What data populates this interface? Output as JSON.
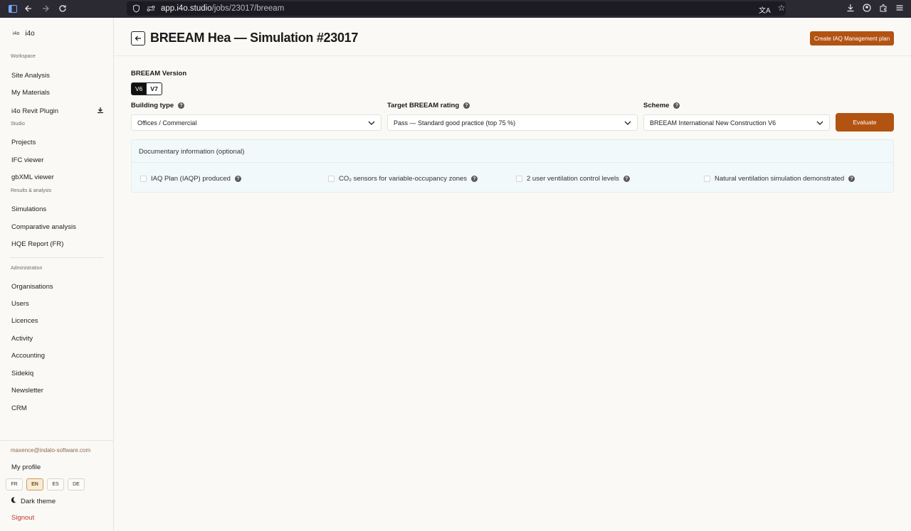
{
  "browser": {
    "url_host": "app.i4o.studio",
    "url_path": "/jobs/23017/breeam"
  },
  "logo": {
    "mark": "i4o",
    "name": "i4o"
  },
  "sidebar": {
    "workspace_heading": "Workspace",
    "workspace": [
      "Site Analysis",
      "My Materials",
      "i4o Revit Plugin"
    ],
    "studio_heading": "Studio",
    "studio": [
      "Projects",
      "IFC viewer",
      "gbXML viewer"
    ],
    "results_heading": "Results & analysis",
    "results": [
      "Simulations",
      "Comparative analysis",
      "HQE Report (FR)"
    ],
    "admin_heading": "Administration",
    "admin": [
      "Organisations",
      "Users",
      "Licences",
      "Activity",
      "Accounting",
      "Sidekiq",
      "Newsletter",
      "CRM"
    ],
    "user_email": "maxence@indalo-software.com",
    "my_profile": "My profile",
    "languages": [
      "FR",
      "EN",
      "ES",
      "DE"
    ],
    "active_language": "EN",
    "dark_theme": "Dark theme",
    "signout": "Signout"
  },
  "header": {
    "title": "BREEAM Hea — Simulation #23017",
    "create_plan": "Create IAQ Management plan"
  },
  "form": {
    "version_label": "BREEAM Version",
    "versions": [
      "V6",
      "V7"
    ],
    "selected_version": "V6",
    "building_type_label": "Building type",
    "building_type_value": "Offices / Commercial",
    "target_label": "Target BREEAM rating",
    "target_value": "Pass — Standard good practice (top 75 %)",
    "scheme_label": "Scheme",
    "scheme_value": "BREEAM International New Construction V6",
    "evaluate": "Evaluate"
  },
  "documentary": {
    "title": "Documentary information (optional)",
    "items": [
      "IAQ Plan (IAQP) produced",
      "CO₂ sensors for variable-occupancy zones",
      "2 user ventilation control levels",
      "Natural ventilation simulation demonstrated"
    ]
  },
  "colors": {
    "accent": "#b35312",
    "panel": "#f1f9fa"
  }
}
